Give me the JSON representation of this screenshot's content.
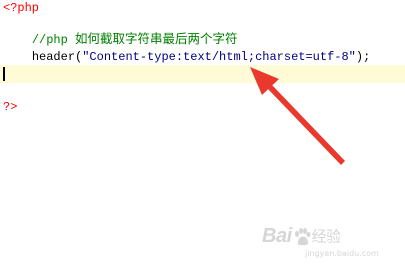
{
  "editor": {
    "lines": {
      "open_tag": "<?php",
      "comment_prefix": "//php ",
      "comment_text": "如何截取字符串最后两个字符",
      "header_func": "header(",
      "header_arg": "\"Content-type:text/html;charset=utf-8\"",
      "header_end": ");",
      "close_tag": "?>"
    },
    "colors": {
      "tag": "#ff0000",
      "comment": "#008000",
      "plain": "#000000",
      "string": "#000080",
      "current_line": "#fffbd6",
      "arrow": "#e8392c"
    }
  },
  "watermark": {
    "brand_left": "Bai",
    "brand_right": "经验",
    "url": "jingyan.baidu.com"
  }
}
